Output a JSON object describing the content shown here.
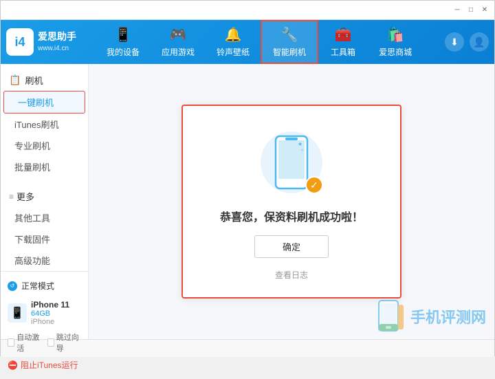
{
  "titleBar": {
    "controls": [
      "minimize",
      "maximize",
      "close"
    ]
  },
  "header": {
    "logo": {
      "brand": "爱思助手",
      "url": "www.i4.cn"
    },
    "tabs": [
      {
        "id": "my-device",
        "label": "我的设备",
        "icon": "📱",
        "active": false
      },
      {
        "id": "apps-games",
        "label": "应用游戏",
        "icon": "🎮",
        "active": false
      },
      {
        "id": "ringtones",
        "label": "铃声壁纸",
        "icon": "🔔",
        "active": false
      },
      {
        "id": "smart-flash",
        "label": "智能刷机",
        "icon": "🔧",
        "active": true
      },
      {
        "id": "toolbox",
        "label": "工具箱",
        "icon": "🧰",
        "active": false
      },
      {
        "id": "store",
        "label": "爱思商城",
        "icon": "🛍️",
        "active": false
      }
    ]
  },
  "sidebar": {
    "section_flash": {
      "icon": "📋",
      "label": "刷机"
    },
    "items_flash": [
      {
        "id": "one-click-flash",
        "label": "一键刷机",
        "active": true
      },
      {
        "id": "itunes-flash",
        "label": "iTunes刷机",
        "active": false
      },
      {
        "id": "pro-flash",
        "label": "专业刷机",
        "active": false
      },
      {
        "id": "batch-flash",
        "label": "批量刷机",
        "active": false
      }
    ],
    "section_more": {
      "icon": "≡",
      "label": "更多"
    },
    "items_more": [
      {
        "id": "other-tools",
        "label": "其他工具",
        "active": false
      },
      {
        "id": "download-fw",
        "label": "下载固件",
        "active": false
      },
      {
        "id": "advanced",
        "label": "高级功能",
        "active": false
      }
    ],
    "mode": {
      "label": "正常模式"
    },
    "device": {
      "name": "iPhone 11",
      "storage": "64GB",
      "model": "iPhone"
    },
    "checkboxes": [
      {
        "id": "auto-activate",
        "label": "自动激活",
        "checked": false
      },
      {
        "id": "skip-guide",
        "label": "跳过向导",
        "checked": false
      }
    ],
    "itunes_stop": "阻止iTunes运行"
  },
  "successDialog": {
    "message": "恭喜您，保资料刷机成功啦！",
    "confirmButton": "确定",
    "historyLink": "查看日志"
  },
  "watermark": {
    "text": "手机评测网"
  }
}
